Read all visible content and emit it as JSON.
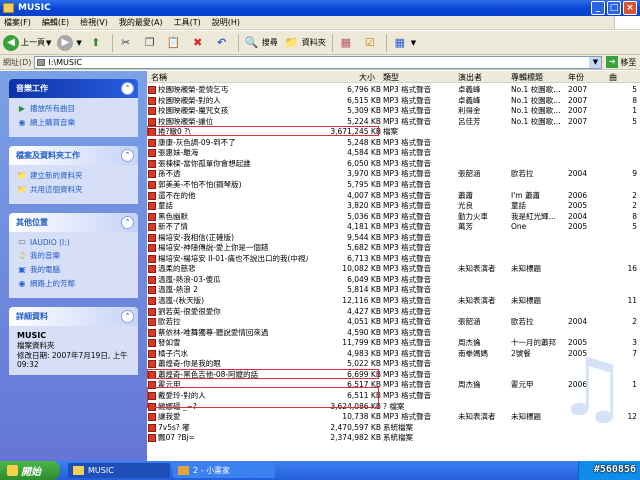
{
  "window": {
    "title": "MUSIC",
    "minimize": "_",
    "maximize": "□",
    "close": "×"
  },
  "menu": [
    "檔案(F)",
    "編輯(E)",
    "檢視(V)",
    "我的最愛(A)",
    "工具(T)",
    "說明(H)"
  ],
  "toolbar": {
    "back": "上一頁",
    "search": "搜尋",
    "folders": "資料夾"
  },
  "address": {
    "label": "網址(D)",
    "value": "I:\\MUSIC",
    "go": "移至"
  },
  "left_panels": {
    "music_tasks": {
      "title": "音樂工作",
      "items": [
        "播放所有曲目",
        "網上購買音樂"
      ]
    },
    "file_tasks": {
      "title": "檔案及資料夾工作",
      "items": [
        "建立新的資料夾",
        "共用這個資料夾"
      ]
    },
    "other_places": {
      "title": "其他位置",
      "items": [
        "IAUDIO (I:)",
        "我的音樂",
        "我的電腦",
        "網路上的芳鄰"
      ]
    },
    "details": {
      "title": "詳細資料",
      "name": "MUSIC",
      "kind": "檔案資料夾",
      "modified": "修改日期: 2007年7月19日, 上午 09:32"
    }
  },
  "columns": {
    "name": "名稱",
    "size": "大小",
    "type": "類型",
    "artist": "演出者",
    "album": "專輯標題",
    "year": "年份",
    "track": "曲"
  },
  "files": [
    {
      "name": "校園映襯榮-愛情乞丐",
      "size": "6,796 KB",
      "type": "MP3 格式聲音",
      "artist": "卓義峰",
      "album": "No.1 校園歌…",
      "year": "2007",
      "track": "5"
    },
    {
      "name": "校園映襯榮-對的人",
      "size": "6,515 KB",
      "type": "MP3 格式聲音",
      "artist": "卓義峰",
      "album": "No.1 校園歌…",
      "year": "2007",
      "track": "8"
    },
    {
      "name": "校園映襯榮-魔咒女孩",
      "size": "5,309 KB",
      "type": "MP3 格式聲音",
      "artist": "利得金",
      "album": "No.1 校園歌…",
      "year": "2007",
      "track": "1"
    },
    {
      "name": "校園映襯榮-讓位",
      "size": "5,224 KB",
      "type": "MP3 格式聲音",
      "artist": "呂佳芳",
      "album": "No.1 校園歌…",
      "year": "2007",
      "track": "5"
    },
    {
      "name": "捲?轍0 ?\\",
      "size": "3,671,245 KB",
      "type": "檔案",
      "artist": "",
      "album": "",
      "year": "",
      "track": ""
    },
    {
      "name": "康康-灰色調-09-到不了",
      "size": "5,248 KB",
      "type": "MP3 格式聲音",
      "artist": "",
      "album": "",
      "year": "",
      "track": ""
    },
    {
      "name": "張惠妹-離海",
      "size": "4,584 KB",
      "type": "MP3 格式聲音",
      "artist": "",
      "album": "",
      "year": "",
      "track": ""
    },
    {
      "name": "張棟樑-當你孤單你會想起誰",
      "size": "6,050 KB",
      "type": "MP3 格式聲音",
      "artist": "",
      "album": "",
      "year": "",
      "track": ""
    },
    {
      "name": "孫不透",
      "size": "3,970 KB",
      "type": "MP3 格式聲音",
      "artist": "張韶涵",
      "album": "歐若拉",
      "year": "2004",
      "track": "9"
    },
    {
      "name": "郭美美-不怕不怕(鋼琴版)",
      "size": "5,795 KB",
      "type": "MP3 格式聲音",
      "artist": "",
      "album": "",
      "year": "",
      "track": ""
    },
    {
      "name": "還不在的他",
      "size": "4,007 KB",
      "type": "MP3 格式聲音",
      "artist": "蕭蕭",
      "album": "I'm 蕭蕭",
      "year": "2006",
      "track": "2"
    },
    {
      "name": "童話",
      "size": "3,820 KB",
      "type": "MP3 格式聲音",
      "artist": "光良",
      "album": "童話",
      "year": "2005",
      "track": "2"
    },
    {
      "name": "黑色幽默",
      "size": "5,036 KB",
      "type": "MP3 格式聲音",
      "artist": "勤力火車",
      "album": "我是紅光輝…",
      "year": "2004",
      "track": "8"
    },
    {
      "name": "新不了情",
      "size": "4,181 KB",
      "type": "MP3 格式聲音",
      "artist": "萬芳",
      "album": "One",
      "year": "2005",
      "track": "5"
    },
    {
      "name": "楊培安-我相信(正確版)",
      "size": "9,544 KB",
      "type": "MP3 格式聲音",
      "artist": "",
      "album": "",
      "year": "",
      "track": ""
    },
    {
      "name": "楊培安-神隱傳說-愛上你是一個錯",
      "size": "5,682 KB",
      "type": "MP3 格式聲音",
      "artist": "",
      "album": "",
      "year": "",
      "track": ""
    },
    {
      "name": "楊培安-楊培安 II-01-痛也不說出口的我(中視八…",
      "size": "6,713 KB",
      "type": "MP3 格式聲音",
      "artist": "",
      "album": "",
      "year": "",
      "track": ""
    },
    {
      "name": "溫柔的慈悲",
      "size": "10,082 KB",
      "type": "MP3 格式聲音",
      "artist": "未知表演者",
      "album": "未知標題",
      "year": "",
      "track": "16"
    },
    {
      "name": "溫嵐-熱浪-03-傻瓜",
      "size": "6,049 KB",
      "type": "MP3 格式聲音",
      "artist": "",
      "album": "",
      "year": "",
      "track": ""
    },
    {
      "name": "溫嵐-熱浪 2",
      "size": "5,814 KB",
      "type": "MP3 格式聲音",
      "artist": "",
      "album": "",
      "year": "",
      "track": ""
    },
    {
      "name": "溫嵐-(秋天版)",
      "size": "12,116 KB",
      "type": "MP3 格式聲音",
      "artist": "未知表演者",
      "album": "未知標題",
      "year": "",
      "track": "11"
    },
    {
      "name": "劉若英-很愛很愛你",
      "size": "4,427 KB",
      "type": "MP3 格式聲音",
      "artist": "",
      "album": "",
      "year": "",
      "track": ""
    },
    {
      "name": "歐若拉",
      "size": "4,051 KB",
      "type": "MP3 格式聲音",
      "artist": "張韶涵",
      "album": "歐若拉",
      "year": "2004",
      "track": "2"
    },
    {
      "name": "蔡依林-唯舞獨尊-聽說愛情回來過",
      "size": "4,590 KB",
      "type": "MP3 格式聲音",
      "artist": "",
      "album": "",
      "year": "",
      "track": ""
    },
    {
      "name": "發如雪",
      "size": "11,799 KB",
      "type": "MP3 格式聲音",
      "artist": "周杰倫",
      "album": "十一月的蕭邦",
      "year": "2005",
      "track": "3"
    },
    {
      "name": "橘子汽水",
      "size": "4,983 KB",
      "type": "MP3 格式聲音",
      "artist": "南拳媽媽",
      "album": "2號餐",
      "year": "2005",
      "track": "7"
    },
    {
      "name": "蕭煌奇-你是我的眼",
      "size": "5,022 KB",
      "type": "MP3 格式聲音",
      "artist": "",
      "album": "",
      "year": "",
      "track": ""
    },
    {
      "name": "蕭煌奇-黑色吉他-08-阿嬤的話",
      "size": "6,699 KB",
      "type": "MP3 格式聲音",
      "artist": "",
      "album": "",
      "year": "",
      "track": ""
    },
    {
      "name": "霍元甲",
      "size": "6,517 KB",
      "type": "MP3 格式聲音",
      "artist": "周杰倫",
      "album": "霍元甲",
      "year": "2006",
      "track": "1"
    },
    {
      "name": "戴愛玲-對的人",
      "size": "6,511 KB",
      "type": "MP3 格式聲音",
      "artist": "",
      "album": "",
      "year": "",
      "track": ""
    },
    {
      "name": "饒娜礓  _~?",
      "size": "3,624,086 KB",
      "type": "? 檔案",
      "artist": "",
      "album": "",
      "year": "",
      "track": ""
    },
    {
      "name": "讓我愛",
      "size": "10,738 KB",
      "type": "MP3 格式聲音",
      "artist": "未知表演者",
      "album": "未知標題",
      "year": "",
      "track": "12"
    },
    {
      "name": "7v5s?  嘟",
      "size": "2,470,597 KB",
      "type": "系統檔案",
      "artist": "",
      "album": "",
      "year": "",
      "track": ""
    },
    {
      "name": "飄07 ?Bj=",
      "size": "2,374,982 KB",
      "type": "系統檔案",
      "artist": "",
      "album": "",
      "year": "",
      "track": ""
    }
  ],
  "taskbar": {
    "start": "開始",
    "tasks": [
      "MUSIC",
      "2 - 小畫家"
    ]
  },
  "watermark": "#560856"
}
